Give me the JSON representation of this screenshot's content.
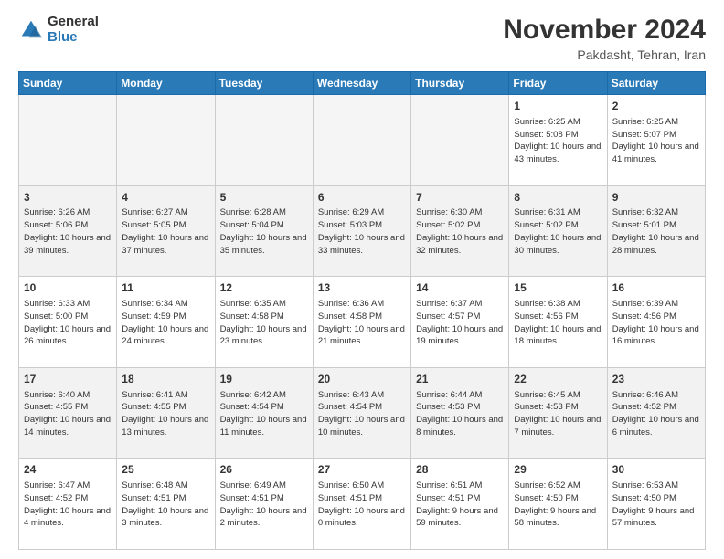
{
  "logo": {
    "general": "General",
    "blue": "Blue"
  },
  "title": {
    "month": "November 2024",
    "location": "Pakdasht, Tehran, Iran"
  },
  "weekdays": [
    "Sunday",
    "Monday",
    "Tuesday",
    "Wednesday",
    "Thursday",
    "Friday",
    "Saturday"
  ],
  "rows": [
    {
      "cells": [
        {
          "day": "",
          "empty": true
        },
        {
          "day": "",
          "empty": true
        },
        {
          "day": "",
          "empty": true
        },
        {
          "day": "",
          "empty": true
        },
        {
          "day": "",
          "empty": true
        },
        {
          "day": "1",
          "sunrise": "Sunrise: 6:25 AM",
          "sunset": "Sunset: 5:08 PM",
          "daylight": "Daylight: 10 hours and 43 minutes."
        },
        {
          "day": "2",
          "sunrise": "Sunrise: 6:25 AM",
          "sunset": "Sunset: 5:07 PM",
          "daylight": "Daylight: 10 hours and 41 minutes."
        }
      ]
    },
    {
      "cells": [
        {
          "day": "3",
          "sunrise": "Sunrise: 6:26 AM",
          "sunset": "Sunset: 5:06 PM",
          "daylight": "Daylight: 10 hours and 39 minutes."
        },
        {
          "day": "4",
          "sunrise": "Sunrise: 6:27 AM",
          "sunset": "Sunset: 5:05 PM",
          "daylight": "Daylight: 10 hours and 37 minutes."
        },
        {
          "day": "5",
          "sunrise": "Sunrise: 6:28 AM",
          "sunset": "Sunset: 5:04 PM",
          "daylight": "Daylight: 10 hours and 35 minutes."
        },
        {
          "day": "6",
          "sunrise": "Sunrise: 6:29 AM",
          "sunset": "Sunset: 5:03 PM",
          "daylight": "Daylight: 10 hours and 33 minutes."
        },
        {
          "day": "7",
          "sunrise": "Sunrise: 6:30 AM",
          "sunset": "Sunset: 5:02 PM",
          "daylight": "Daylight: 10 hours and 32 minutes."
        },
        {
          "day": "8",
          "sunrise": "Sunrise: 6:31 AM",
          "sunset": "Sunset: 5:02 PM",
          "daylight": "Daylight: 10 hours and 30 minutes."
        },
        {
          "day": "9",
          "sunrise": "Sunrise: 6:32 AM",
          "sunset": "Sunset: 5:01 PM",
          "daylight": "Daylight: 10 hours and 28 minutes."
        }
      ]
    },
    {
      "cells": [
        {
          "day": "10",
          "sunrise": "Sunrise: 6:33 AM",
          "sunset": "Sunset: 5:00 PM",
          "daylight": "Daylight: 10 hours and 26 minutes."
        },
        {
          "day": "11",
          "sunrise": "Sunrise: 6:34 AM",
          "sunset": "Sunset: 4:59 PM",
          "daylight": "Daylight: 10 hours and 24 minutes."
        },
        {
          "day": "12",
          "sunrise": "Sunrise: 6:35 AM",
          "sunset": "Sunset: 4:58 PM",
          "daylight": "Daylight: 10 hours and 23 minutes."
        },
        {
          "day": "13",
          "sunrise": "Sunrise: 6:36 AM",
          "sunset": "Sunset: 4:58 PM",
          "daylight": "Daylight: 10 hours and 21 minutes."
        },
        {
          "day": "14",
          "sunrise": "Sunrise: 6:37 AM",
          "sunset": "Sunset: 4:57 PM",
          "daylight": "Daylight: 10 hours and 19 minutes."
        },
        {
          "day": "15",
          "sunrise": "Sunrise: 6:38 AM",
          "sunset": "Sunset: 4:56 PM",
          "daylight": "Daylight: 10 hours and 18 minutes."
        },
        {
          "day": "16",
          "sunrise": "Sunrise: 6:39 AM",
          "sunset": "Sunset: 4:56 PM",
          "daylight": "Daylight: 10 hours and 16 minutes."
        }
      ]
    },
    {
      "cells": [
        {
          "day": "17",
          "sunrise": "Sunrise: 6:40 AM",
          "sunset": "Sunset: 4:55 PM",
          "daylight": "Daylight: 10 hours and 14 minutes."
        },
        {
          "day": "18",
          "sunrise": "Sunrise: 6:41 AM",
          "sunset": "Sunset: 4:55 PM",
          "daylight": "Daylight: 10 hours and 13 minutes."
        },
        {
          "day": "19",
          "sunrise": "Sunrise: 6:42 AM",
          "sunset": "Sunset: 4:54 PM",
          "daylight": "Daylight: 10 hours and 11 minutes."
        },
        {
          "day": "20",
          "sunrise": "Sunrise: 6:43 AM",
          "sunset": "Sunset: 4:54 PM",
          "daylight": "Daylight: 10 hours and 10 minutes."
        },
        {
          "day": "21",
          "sunrise": "Sunrise: 6:44 AM",
          "sunset": "Sunset: 4:53 PM",
          "daylight": "Daylight: 10 hours and 8 minutes."
        },
        {
          "day": "22",
          "sunrise": "Sunrise: 6:45 AM",
          "sunset": "Sunset: 4:53 PM",
          "daylight": "Daylight: 10 hours and 7 minutes."
        },
        {
          "day": "23",
          "sunrise": "Sunrise: 6:46 AM",
          "sunset": "Sunset: 4:52 PM",
          "daylight": "Daylight: 10 hours and 6 minutes."
        }
      ]
    },
    {
      "cells": [
        {
          "day": "24",
          "sunrise": "Sunrise: 6:47 AM",
          "sunset": "Sunset: 4:52 PM",
          "daylight": "Daylight: 10 hours and 4 minutes."
        },
        {
          "day": "25",
          "sunrise": "Sunrise: 6:48 AM",
          "sunset": "Sunset: 4:51 PM",
          "daylight": "Daylight: 10 hours and 3 minutes."
        },
        {
          "day": "26",
          "sunrise": "Sunrise: 6:49 AM",
          "sunset": "Sunset: 4:51 PM",
          "daylight": "Daylight: 10 hours and 2 minutes."
        },
        {
          "day": "27",
          "sunrise": "Sunrise: 6:50 AM",
          "sunset": "Sunset: 4:51 PM",
          "daylight": "Daylight: 10 hours and 0 minutes."
        },
        {
          "day": "28",
          "sunrise": "Sunrise: 6:51 AM",
          "sunset": "Sunset: 4:51 PM",
          "daylight": "Daylight: 9 hours and 59 minutes."
        },
        {
          "day": "29",
          "sunrise": "Sunrise: 6:52 AM",
          "sunset": "Sunset: 4:50 PM",
          "daylight": "Daylight: 9 hours and 58 minutes."
        },
        {
          "day": "30",
          "sunrise": "Sunrise: 6:53 AM",
          "sunset": "Sunset: 4:50 PM",
          "daylight": "Daylight: 9 hours and 57 minutes."
        }
      ]
    }
  ]
}
